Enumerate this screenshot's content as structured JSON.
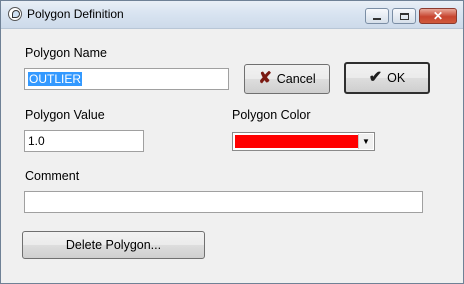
{
  "window": {
    "title": "Polygon Definition",
    "icon": "polygon-app-icon"
  },
  "fields": {
    "polygon_name_label": "Polygon Name",
    "polygon_name_value": "OUTLIER",
    "polygon_value_label": "Polygon Value",
    "polygon_value_value": "1.0",
    "polygon_color_label": "Polygon Color",
    "polygon_color_value": "#ff0000",
    "comment_label": "Comment",
    "comment_value": ""
  },
  "buttons": {
    "cancel_label": "Cancel",
    "ok_label": "OK",
    "delete_label": "Delete Polygon..."
  },
  "icons": {
    "cancel": "x-icon",
    "ok": "checkmark-icon",
    "dropdown": "chevron-down-icon"
  }
}
